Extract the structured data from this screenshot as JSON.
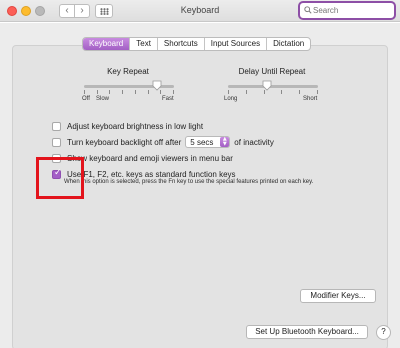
{
  "window": {
    "title": "Keyboard"
  },
  "toolbar": {
    "back_icon": "chevron-left-icon",
    "forward_icon": "chevron-right-icon",
    "grid_icon": "show-all-grid-icon",
    "search_placeholder": "Search"
  },
  "tabs": [
    {
      "label": "Keyboard",
      "active": true
    },
    {
      "label": "Text",
      "active": false
    },
    {
      "label": "Shortcuts",
      "active": false
    },
    {
      "label": "Input Sources",
      "active": false
    },
    {
      "label": "Dictation",
      "active": false
    }
  ],
  "key_repeat": {
    "label": "Key Repeat",
    "min_labels": [
      "Off",
      "Slow"
    ],
    "max_label": "Fast",
    "value_fraction": 0.85
  },
  "delay_until_repeat": {
    "label": "Delay Until Repeat",
    "min_label": "Long",
    "max_label": "Short",
    "value_fraction": 0.42
  },
  "options": {
    "brightness": {
      "label": "Adjust keyboard brightness in low light",
      "checked": false
    },
    "backlight": {
      "label_before": "Turn keyboard backlight off after",
      "select_value": "5 secs",
      "label_after": "of inactivity",
      "checked": false
    },
    "viewers": {
      "label": "Show keyboard and emoji viewers in menu bar",
      "checked": false
    },
    "fn_keys": {
      "label": "Use F1, F2, etc. keys as standard function keys",
      "checked": true,
      "description": "When this option is selected, press the Fn key to use the special features printed on each key."
    }
  },
  "buttons": {
    "modifier_keys": "Modifier Keys...",
    "bluetooth": "Set Up Bluetooth Keyboard...",
    "help": "?"
  },
  "colors": {
    "accent": "#a45fc7",
    "search_focus": "#8d4fa6",
    "highlight_box": "#e3141c"
  }
}
